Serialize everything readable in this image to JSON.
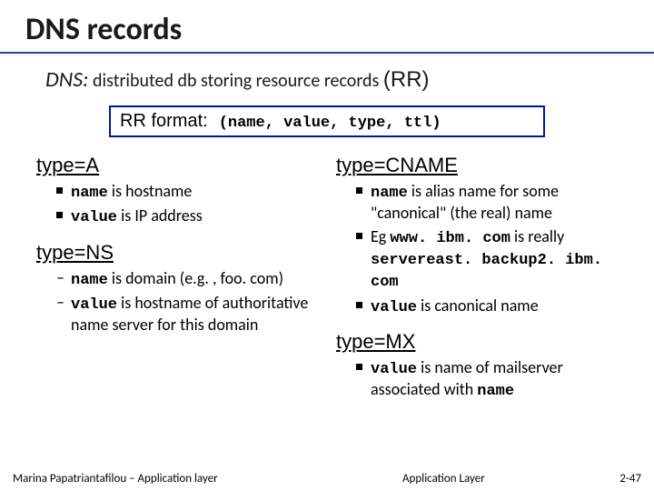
{
  "title": "DNS records",
  "subtitle": {
    "prefix": "DNS:",
    "text": "distributed db storing resource records",
    "abbr": "(RR)"
  },
  "rrformat": {
    "label": "RR format:",
    "tuple": "(name, value, type, ttl)"
  },
  "typeA": {
    "head": "type=A",
    "b1_a": "name",
    "b1_b": " is hostname",
    "b2_a": "value",
    "b2_b": " is IP address"
  },
  "typeNS": {
    "head": "type=NS",
    "b1_a": "name",
    "b1_b": " is domain (e.g. , foo. com)",
    "b2_a": "value",
    "b2_b": " is hostname of authoritative name server for this domain"
  },
  "typeCNAME": {
    "head": "type=CNAME",
    "b1_a": "name",
    "b1_b": " is alias name for some \"canonical\" (the real) name",
    "b2_a": "Eg ",
    "b2_b": "www. ibm. com",
    "b2_c": " is really ",
    "b2_d": "servereast. backup2. ibm. com",
    "b3_a": "value",
    "b3_b": " is canonical name"
  },
  "typeMX": {
    "head": "type=MX",
    "b1_a": "value",
    "b1_b": " is name of mailserver associated with ",
    "b1_c": "name"
  },
  "footer": {
    "left": "Marina Papatriantafilou – Application layer",
    "mid": "Application Layer",
    "right": "2-47"
  }
}
